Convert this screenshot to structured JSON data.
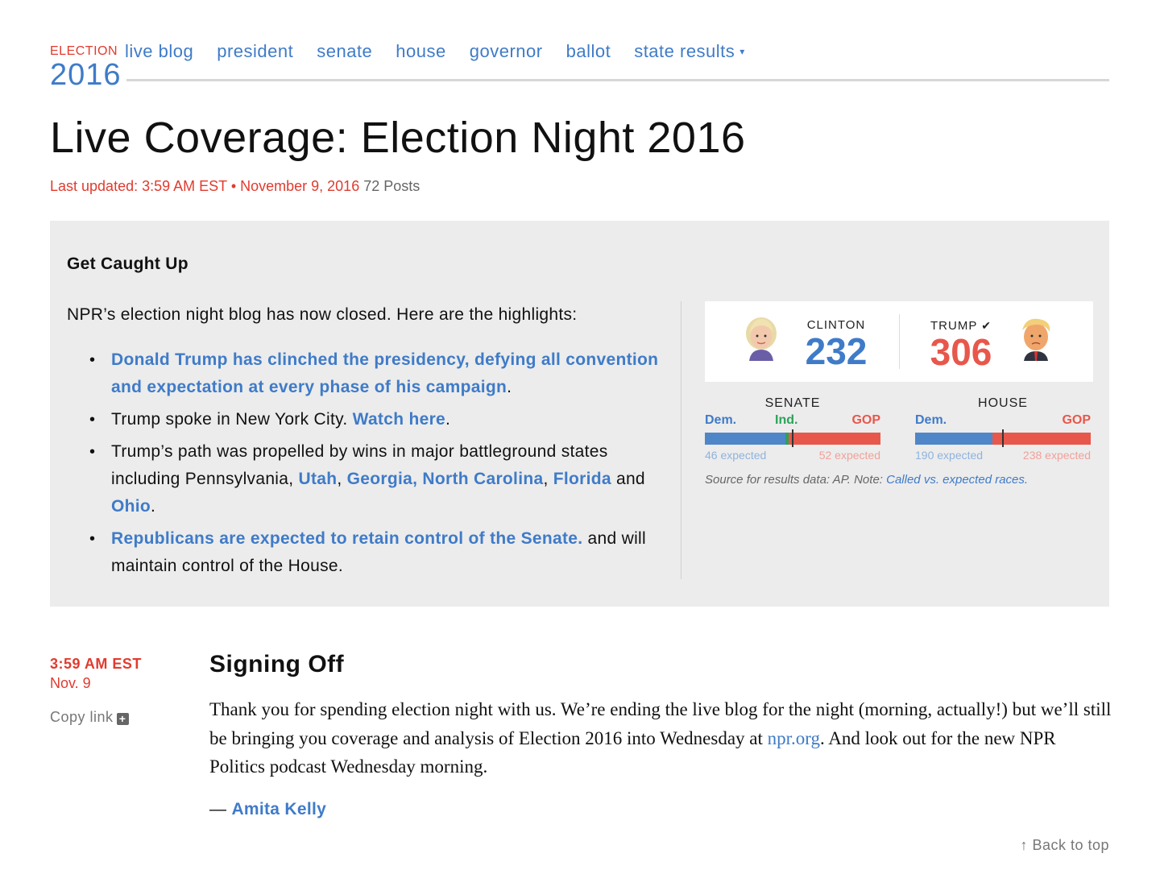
{
  "brand": {
    "election": "ELECTION",
    "year": "2016"
  },
  "nav": {
    "items": [
      "live blog",
      "president",
      "senate",
      "house",
      "governor",
      "ballot",
      "state results"
    ],
    "dropdown_caret": "▾"
  },
  "page": {
    "title": "Live Coverage: Election Night 2016",
    "updated": "Last updated: 3:59 AM EST • November 9, 2016",
    "posts": "72 Posts"
  },
  "catchup": {
    "heading": "Get Caught Up",
    "intro": "NPR’s election night blog has now closed. Here are the highlights:",
    "b1_link": "Donald Trump has clinched the presidency, defying all convention and expectation at every phase of his campaign",
    "b1_tail": ".",
    "b2_text": "Trump spoke in New York City. ",
    "b2_link": "Watch here",
    "b2_tail": ".",
    "b3_text": "Trump’s path was propelled by wins in major battleground states including Pennsylvania, ",
    "b3_link1": "Utah",
    "b3_sep1": ", ",
    "b3_link2": "Georgia, North Carolina",
    "b3_sep2": ", ",
    "b3_link3": "Florida",
    "b3_and": " and ",
    "b3_link4": "Ohio",
    "b3_tail": ".",
    "b4_link": "Republicans are expected to retain control of the Senate.",
    "b4_text": " and will maintain control of the House."
  },
  "results": {
    "clinton": {
      "name": "CLINTON",
      "votes": "232",
      "color": "#3f7bc8"
    },
    "trump": {
      "name": "TRUMP",
      "check": "✔",
      "votes": "306",
      "color": "#e8574b"
    },
    "senate": {
      "title": "SENATE",
      "dem_label": "Dem.",
      "ind_label": "Ind.",
      "gop_label": "GOP",
      "dem_share": 0.46,
      "ind_share": 0.02,
      "gop_share": 0.52,
      "dem_expected": "46 expected",
      "gop_expected": "52 expected"
    },
    "house": {
      "title": "HOUSE",
      "dem_label": "Dem.",
      "gop_label": "GOP",
      "dem_share": 0.44,
      "gop_share": 0.56,
      "dem_expected": "190 expected",
      "gop_expected": "238 expected"
    },
    "source_text": "Source for results data: AP. Note: ",
    "source_link": "Called vs. expected races."
  },
  "post": {
    "time": "3:59 AM EST",
    "date": "Nov. 9",
    "copy_link": "Copy link",
    "title": "Signing Off",
    "body_1": "Thank you for spending election night with us. We’re ending the live blog for the night (morning, actually!) but we’ll still be bringing you coverage and analysis of Election 2016 into Wednesday at ",
    "body_link": "npr.org",
    "body_2": ". And look out for the new NPR Politics podcast Wednesday morning.",
    "byline_dash": "— ",
    "author": "Amita Kelly"
  },
  "back_to_top": "↑ Back to top",
  "colors": {
    "accent_blue": "#3f7bc8",
    "accent_red": "#e13b2e",
    "panel_bg": "#ececec"
  }
}
